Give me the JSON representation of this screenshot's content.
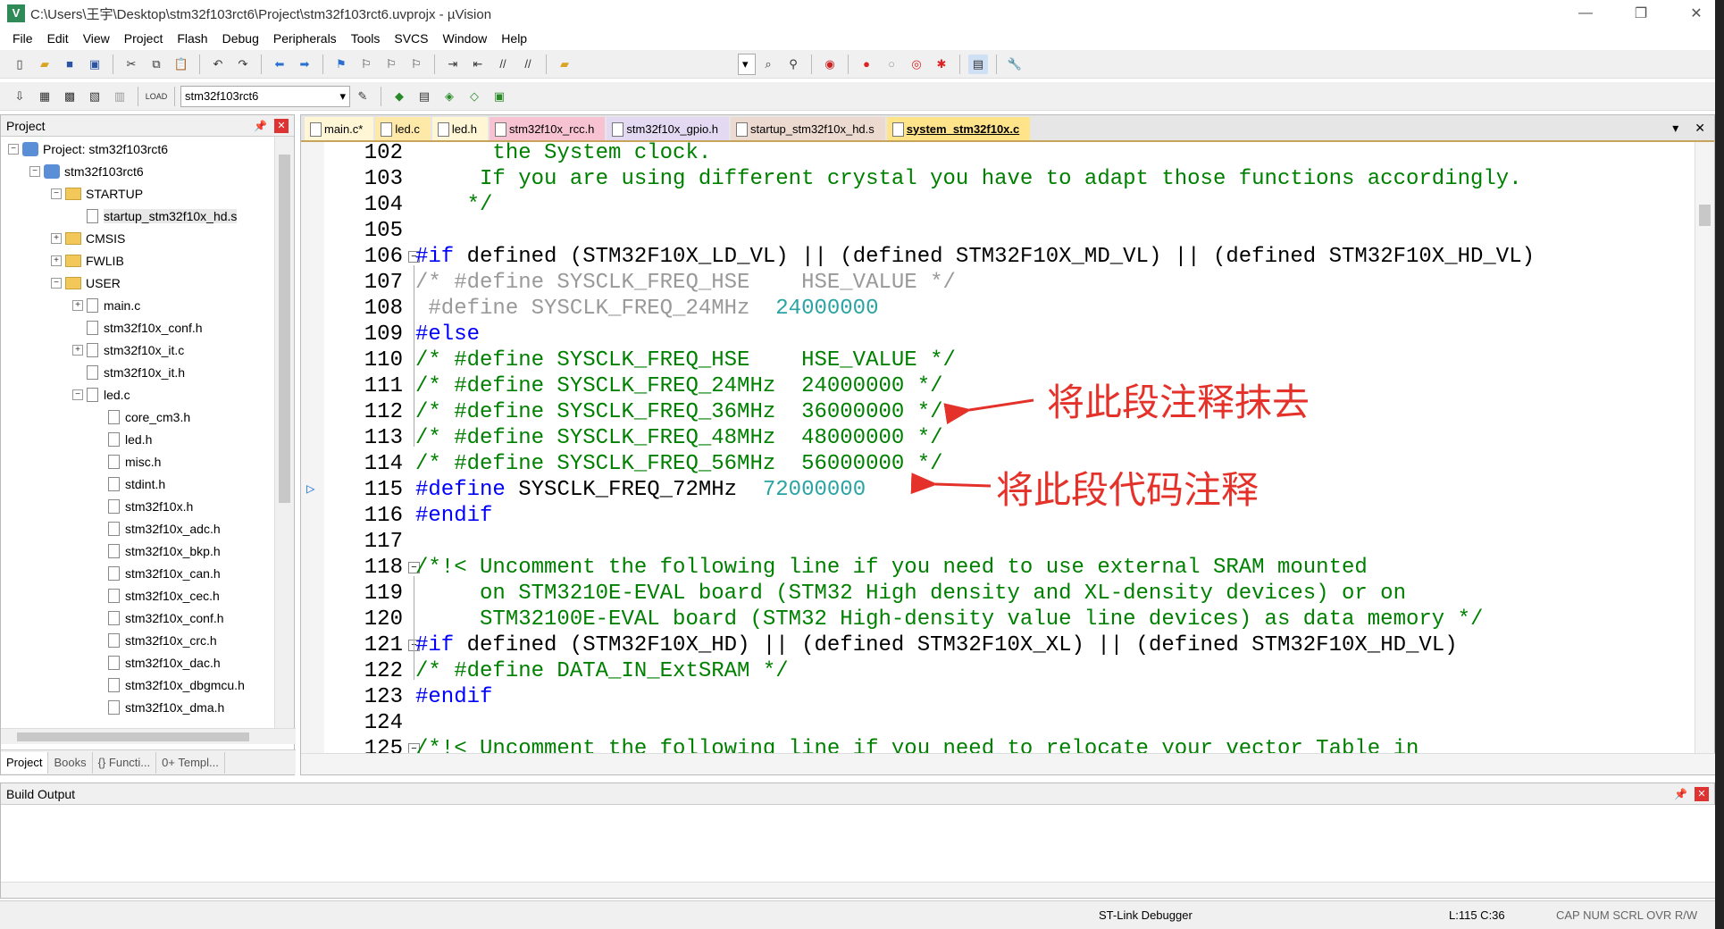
{
  "window": {
    "title": "C:\\Users\\王宇\\Desktop\\stm32f103rct6\\Project\\stm32f103rct6.uvprojx - µVision",
    "controls": [
      "—",
      "❐",
      "✕"
    ]
  },
  "menu": [
    "File",
    "Edit",
    "View",
    "Project",
    "Flash",
    "Debug",
    "Peripherals",
    "Tools",
    "SVCS",
    "Window",
    "Help"
  ],
  "toolbar2": {
    "target": "stm32f103rct6"
  },
  "project_pane": {
    "title": "Project",
    "tree": [
      {
        "label": "Project: stm32f103rct6",
        "level": 0,
        "kind": "project",
        "toggle": "−"
      },
      {
        "label": "stm32f103rct6",
        "level": 1,
        "kind": "target",
        "toggle": "−"
      },
      {
        "label": "STARTUP",
        "level": 2,
        "kind": "folder",
        "toggle": "−"
      },
      {
        "label": "startup_stm32f10x_hd.s",
        "level": 3,
        "kind": "file",
        "toggle": ""
      },
      {
        "label": "CMSIS",
        "level": 2,
        "kind": "folder",
        "toggle": "+"
      },
      {
        "label": "FWLIB",
        "level": 2,
        "kind": "folder",
        "toggle": "+"
      },
      {
        "label": "USER",
        "level": 2,
        "kind": "folder",
        "toggle": "−"
      },
      {
        "label": "main.c",
        "level": 3,
        "kind": "file",
        "toggle": "+"
      },
      {
        "label": "stm32f10x_conf.h",
        "level": 3,
        "kind": "file",
        "toggle": ""
      },
      {
        "label": "stm32f10x_it.c",
        "level": 3,
        "kind": "file",
        "toggle": "+"
      },
      {
        "label": "stm32f10x_it.h",
        "level": 3,
        "kind": "file",
        "toggle": ""
      },
      {
        "label": "led.c",
        "level": 3,
        "kind": "file",
        "toggle": "−"
      },
      {
        "label": "core_cm3.h",
        "level": 4,
        "kind": "file",
        "toggle": ""
      },
      {
        "label": "led.h",
        "level": 4,
        "kind": "file",
        "toggle": ""
      },
      {
        "label": "misc.h",
        "level": 4,
        "kind": "file",
        "toggle": ""
      },
      {
        "label": "stdint.h",
        "level": 4,
        "kind": "file",
        "toggle": ""
      },
      {
        "label": "stm32f10x.h",
        "level": 4,
        "kind": "file",
        "toggle": ""
      },
      {
        "label": "stm32f10x_adc.h",
        "level": 4,
        "kind": "file",
        "toggle": ""
      },
      {
        "label": "stm32f10x_bkp.h",
        "level": 4,
        "kind": "file",
        "toggle": ""
      },
      {
        "label": "stm32f10x_can.h",
        "level": 4,
        "kind": "file",
        "toggle": ""
      },
      {
        "label": "stm32f10x_cec.h",
        "level": 4,
        "kind": "file",
        "toggle": ""
      },
      {
        "label": "stm32f10x_conf.h",
        "level": 4,
        "kind": "file",
        "toggle": ""
      },
      {
        "label": "stm32f10x_crc.h",
        "level": 4,
        "kind": "file",
        "toggle": ""
      },
      {
        "label": "stm32f10x_dac.h",
        "level": 4,
        "kind": "file",
        "toggle": ""
      },
      {
        "label": "stm32f10x_dbgmcu.h",
        "level": 4,
        "kind": "file",
        "toggle": ""
      },
      {
        "label": "stm32f10x_dma.h",
        "level": 4,
        "kind": "file",
        "toggle": ""
      }
    ],
    "bottom_tabs": [
      "Project",
      "Books",
      "{} Functi...",
      "0+ Templ..."
    ]
  },
  "editor": {
    "tabs": [
      {
        "label": "main.c*",
        "color": "#fff6d5"
      },
      {
        "label": "led.c",
        "color": "#ffe9a8"
      },
      {
        "label": "led.h",
        "color": "#fff6d5"
      },
      {
        "label": "stm32f10x_rcc.h",
        "color": "#f7c2d2"
      },
      {
        "label": "stm32f10x_gpio.h",
        "color": "#e3d9f2"
      },
      {
        "label": "startup_stm32f10x_hd.s",
        "color": "#ecdad0"
      },
      {
        "label": "system_stm32f10x.c",
        "color": "#ffe48a"
      }
    ],
    "lines": [
      {
        "n": "102",
        "fold": "",
        "segs": [
          {
            "t": "      the System clock.",
            "c": "cm"
          }
        ]
      },
      {
        "n": "103",
        "fold": "",
        "segs": [
          {
            "t": "     If you are using different crystal you have to adapt those functions accordingly.",
            "c": "cm"
          }
        ]
      },
      {
        "n": "104",
        "fold": "",
        "segs": [
          {
            "t": "    */",
            "c": "cm"
          }
        ]
      },
      {
        "n": "105",
        "fold": "",
        "segs": []
      },
      {
        "n": "106",
        "fold": "−",
        "segs": [
          {
            "t": "#if",
            "c": "kw"
          },
          {
            "t": " defined (STM32F10X_LD_VL) || (defined STM32F10X_MD_VL) || (defined STM32F10X_HD_VL)",
            "c": "dark"
          }
        ]
      },
      {
        "n": "107",
        "fold": "",
        "segs": [
          {
            "t": "/* #define SYSCLK_FREQ_HSE    HSE_VALUE */",
            "c": "grey"
          }
        ]
      },
      {
        "n": "108",
        "fold": "",
        "segs": [
          {
            "t": " #define",
            "c": "grey"
          },
          {
            "t": " SYSCLK_FREQ_24MHz  ",
            "c": "grey"
          },
          {
            "t": "24000000",
            "c": "num"
          }
        ]
      },
      {
        "n": "109",
        "fold": "",
        "segs": [
          {
            "t": "#else",
            "c": "kw"
          }
        ]
      },
      {
        "n": "110",
        "fold": "",
        "segs": [
          {
            "t": "/* #define SYSCLK_FREQ_HSE    HSE_VALUE */",
            "c": "cm"
          }
        ]
      },
      {
        "n": "111",
        "fold": "",
        "segs": [
          {
            "t": "/* #define SYSCLK_FREQ_24MHz  24000000 */",
            "c": "cm"
          }
        ]
      },
      {
        "n": "112",
        "fold": "",
        "segs": [
          {
            "t": "/* #define SYSCLK_FREQ_36MHz  36000000 */",
            "c": "cm"
          }
        ]
      },
      {
        "n": "113",
        "fold": "",
        "segs": [
          {
            "t": "/* #define SYSCLK_FREQ_48MHz  48000000 */",
            "c": "cm"
          }
        ]
      },
      {
        "n": "114",
        "fold": "",
        "segs": [
          {
            "t": "/* #define SYSCLK_FREQ_56MHz  56000000 */",
            "c": "cm"
          }
        ]
      },
      {
        "n": "115",
        "fold": "",
        "segs": [
          {
            "t": "#define",
            "c": "kw"
          },
          {
            "t": " SYSCLK_FREQ_72MHz  ",
            "c": "dark"
          },
          {
            "t": "72000000",
            "c": "num"
          }
        ]
      },
      {
        "n": "116",
        "fold": "",
        "segs": [
          {
            "t": "#endif",
            "c": "kw"
          }
        ]
      },
      {
        "n": "117",
        "fold": "",
        "segs": []
      },
      {
        "n": "118",
        "fold": "−",
        "segs": [
          {
            "t": "/*!< Uncomment the following line if you need to use external SRAM mounted",
            "c": "cm"
          }
        ]
      },
      {
        "n": "119",
        "fold": "",
        "segs": [
          {
            "t": "     on STM3210E-EVAL board (STM32 High density and XL-density devices) or on",
            "c": "cm"
          }
        ]
      },
      {
        "n": "120",
        "fold": "",
        "segs": [
          {
            "t": "     STM32100E-EVAL board (STM32 High-density value line devices) as data memory */",
            "c": "cm"
          }
        ]
      },
      {
        "n": "121",
        "fold": "−",
        "segs": [
          {
            "t": "#if",
            "c": "kw"
          },
          {
            "t": " defined (STM32F10X_HD) || (defined STM32F10X_XL) || (defined STM32F10X_HD_VL)",
            "c": "dark"
          }
        ]
      },
      {
        "n": "122",
        "fold": "",
        "segs": [
          {
            "t": "/* #define DATA_IN_ExtSRAM */",
            "c": "cm"
          }
        ]
      },
      {
        "n": "123",
        "fold": "",
        "segs": [
          {
            "t": "#endif",
            "c": "kw"
          }
        ]
      },
      {
        "n": "124",
        "fold": "",
        "segs": []
      },
      {
        "n": "125",
        "fold": "−",
        "segs": [
          {
            "t": "/*!< Uncomment the following line if you need to relocate your vector Table in",
            "c": "cm"
          }
        ]
      }
    ],
    "annotations": [
      {
        "text": "将此段注释抹去",
        "line": "111"
      },
      {
        "text": "将此段代码注释",
        "line": "115"
      }
    ],
    "colors": {
      "keyword": "#0000ff",
      "comment": "#008000",
      "inactive": "#999999",
      "number": "#2aa3a3",
      "annotation": "#e4322a"
    }
  },
  "build_output": {
    "title": "Build Output"
  },
  "status": {
    "debugger": "ST-Link Debugger",
    "position": "L:115 C:36",
    "flags": "CAP  NUM  SCRL  OVR  R/W"
  }
}
